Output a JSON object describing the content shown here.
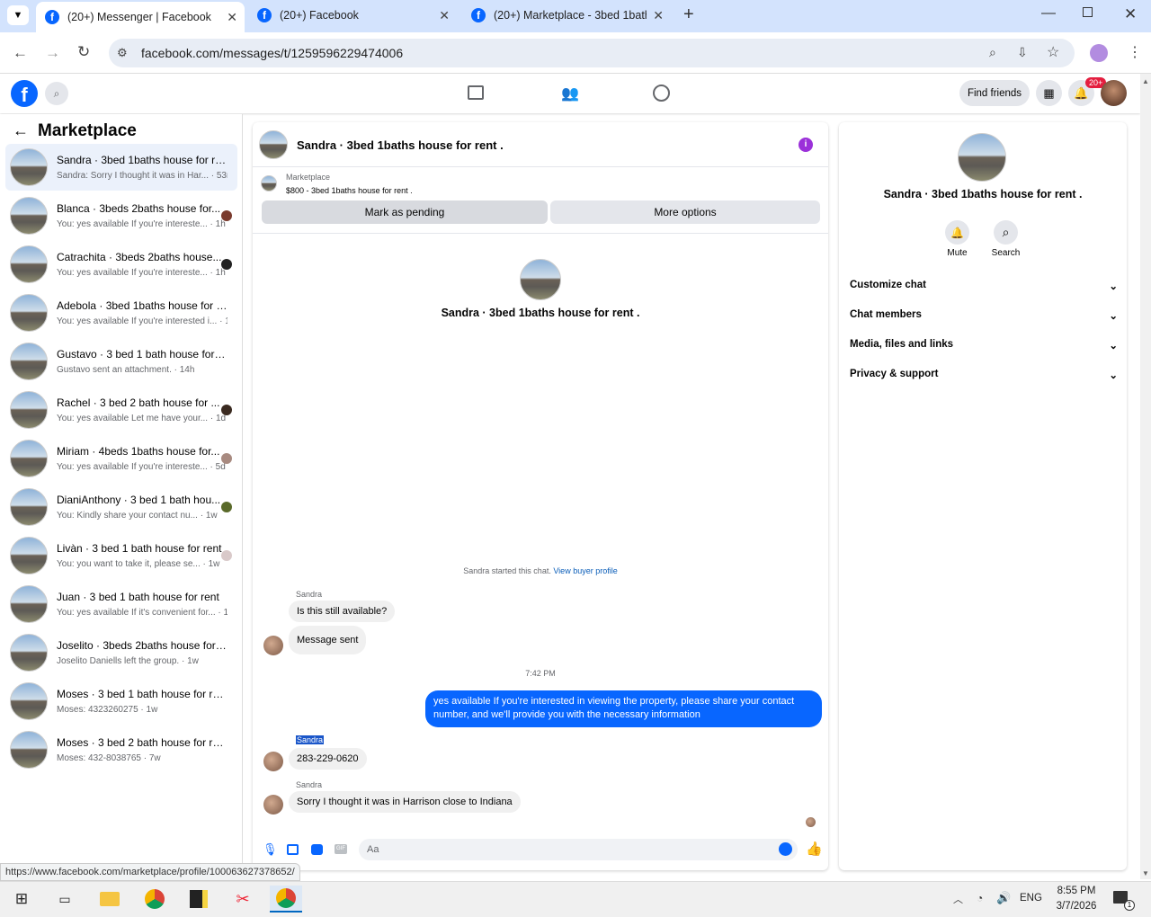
{
  "browser": {
    "tabs": [
      {
        "label": "(20+) Messenger | Facebook"
      },
      {
        "label": "(20+) Facebook"
      },
      {
        "label": "(20+) Marketplace - 3bed 1bath"
      }
    ],
    "url": "facebook.com/messages/t/1259596229474006",
    "status_url": "https://www.facebook.com/marketplace/profile/100063627378652/"
  },
  "fb_header": {
    "find_friends": "Find friends",
    "notif_badge": "20+"
  },
  "marketplace": {
    "title": "Marketplace",
    "conversations": [
      {
        "name": "Sandra · 3bed 1baths house for re...",
        "preview": "Sandra: Sorry I thought it was in Har... · 53m"
      },
      {
        "name": "Blanca · 3beds 2baths house for...",
        "preview": "You: yes available If you're intereste... · 1h"
      },
      {
        "name": "Catrachita · 3beds 2baths house...",
        "preview": "You: yes available If you're intereste... · 1h"
      },
      {
        "name": "Adebola · 3bed 1baths house for r...",
        "preview": "You: yes available If you're interested i... · 1h"
      },
      {
        "name": "Gustavo · 3 bed 1 bath house for r...",
        "preview": "Gustavo sent an attachment. · 14h"
      },
      {
        "name": "Rachel · 3 bed 2 bath house for ...",
        "preview": "You: yes available Let me have your... · 1d"
      },
      {
        "name": "Miriam · 4beds 1baths house for...",
        "preview": "You: yes available If you're intereste... · 5d"
      },
      {
        "name": "DianiAnthony · 3 bed 1 bath hou...",
        "preview": "You: Kindly share your contact nu... · 1w"
      },
      {
        "name": "Livàn · 3 bed 1 bath house for rent",
        "preview": "You: you want to take it, please se... · 1w"
      },
      {
        "name": "Juan · 3 bed 1 bath house for rent",
        "preview": "You: yes available If it's convenient for... · 1w"
      },
      {
        "name": "Joselito · 3beds 2baths house for r...",
        "preview": "Joselito Daniells left the group. · 1w"
      },
      {
        "name": "Moses · 3 bed 1 bath house for rent",
        "preview": "Moses: 4323260275 · 1w"
      },
      {
        "name": "Moses · 3 bed 2 bath house for rent",
        "preview": "Moses: 432-8038765 · 7w"
      }
    ]
  },
  "chat": {
    "title": "Sandra · 3bed 1baths house for rent .",
    "listing_source": "Marketplace",
    "listing": "$800 - 3bed 1baths house for rent .",
    "mark_pending": "Mark as pending",
    "more_options": "More options",
    "intro_name": "Sandra · 3bed 1baths house for rent .",
    "started_text": "Sandra started this chat.",
    "view_profile": "View buyer profile",
    "msg1_sender": "Sandra",
    "msg1": "Is this still available?",
    "msg2": "Message sent",
    "timestamp": "7:42 PM",
    "outgoing": "yes available  If you're interested in viewing the property, please share your contact number, and we'll provide you with the necessary information",
    "msg3_sender": "Sandra",
    "msg3": "283-229-0620",
    "msg4_sender": "Sandra",
    "msg4": "Sorry I thought it was in Harrison close to Indiana",
    "input_placeholder": "Aa"
  },
  "info": {
    "name": "Sandra · 3bed 1baths house for rent .",
    "mute": "Mute",
    "search": "Search",
    "sections": [
      "Customize chat",
      "Chat members",
      "Media, files and links",
      "Privacy & support"
    ]
  },
  "taskbar": {
    "lang": "ENG",
    "time": "8:55 PM",
    "date": "3/7/2026",
    "notif_count": "1"
  }
}
